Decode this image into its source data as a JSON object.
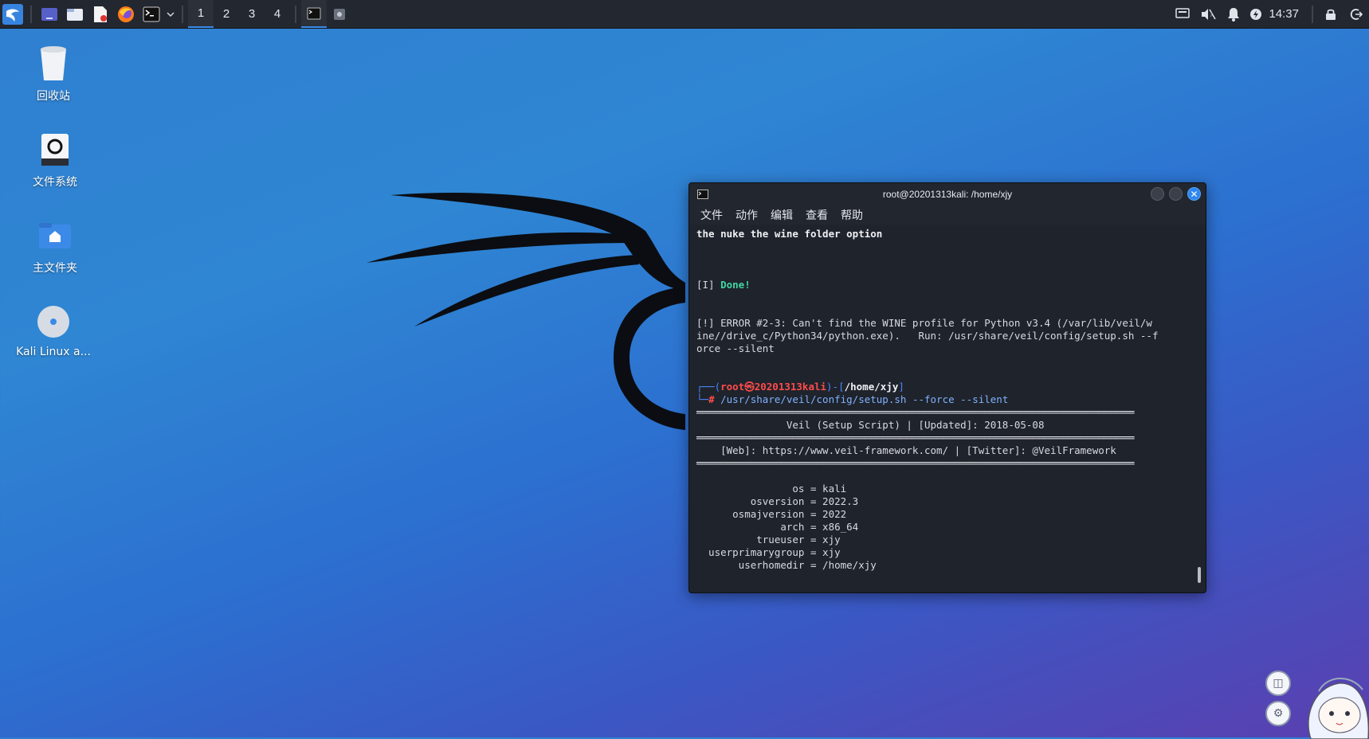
{
  "taskbar": {
    "workspaces": [
      "1",
      "2",
      "3",
      "4"
    ],
    "active_workspace": "1",
    "clock": "14:37"
  },
  "desktop_icons": [
    {
      "label": "回收站",
      "icon": "trash-icon"
    },
    {
      "label": "文件系统",
      "icon": "drive-icon"
    },
    {
      "label": "主文件夹",
      "icon": "home-folder-icon"
    },
    {
      "label": "Kali Linux a...",
      "icon": "disc-icon"
    }
  ],
  "terminal": {
    "title": "root@20201313kali: /home/xjy",
    "menu": [
      "文件",
      "动作",
      "编辑",
      "查看",
      "帮助"
    ],
    "lines": {
      "l1": "the nuke the wine folder option",
      "done_prefix": "[I] ",
      "done": "Done!",
      "error1": "[!] ERROR #2-3: Can't find the WINE profile for Python v3.4 (/var/lib/veil/w",
      "error2": "ine//drive_c/Python34/python.exe).   Run: /usr/share/veil/config/setup.sh --f",
      "error3": "orce --silent",
      "prompt_open": "┌──(",
      "prompt_user": "root㉿20201313kali",
      "prompt_mid": ")-[",
      "prompt_dir": "/home/xjy",
      "prompt_close": "]",
      "prompt2": "└─",
      "hash": "#",
      "command": " /usr/share/veil/config/setup.sh --force --silent",
      "rule": "═════════════════════════════════════════════════════════════════════════",
      "banner": "               Veil (Setup Script) | [Updated]: 2018-05-08",
      "web": "    [Web]: https://www.veil-framework.com/ | [Twitter]: @VeilFramework",
      "kv": [
        "                os = kali",
        "         osversion = 2022.3",
        "      osmajversion = 2022",
        "              arch = x86_64",
        "          trueuser = xjy",
        "  userprimarygroup = xjy",
        "       userhomedir = /home/xjy"
      ]
    }
  }
}
